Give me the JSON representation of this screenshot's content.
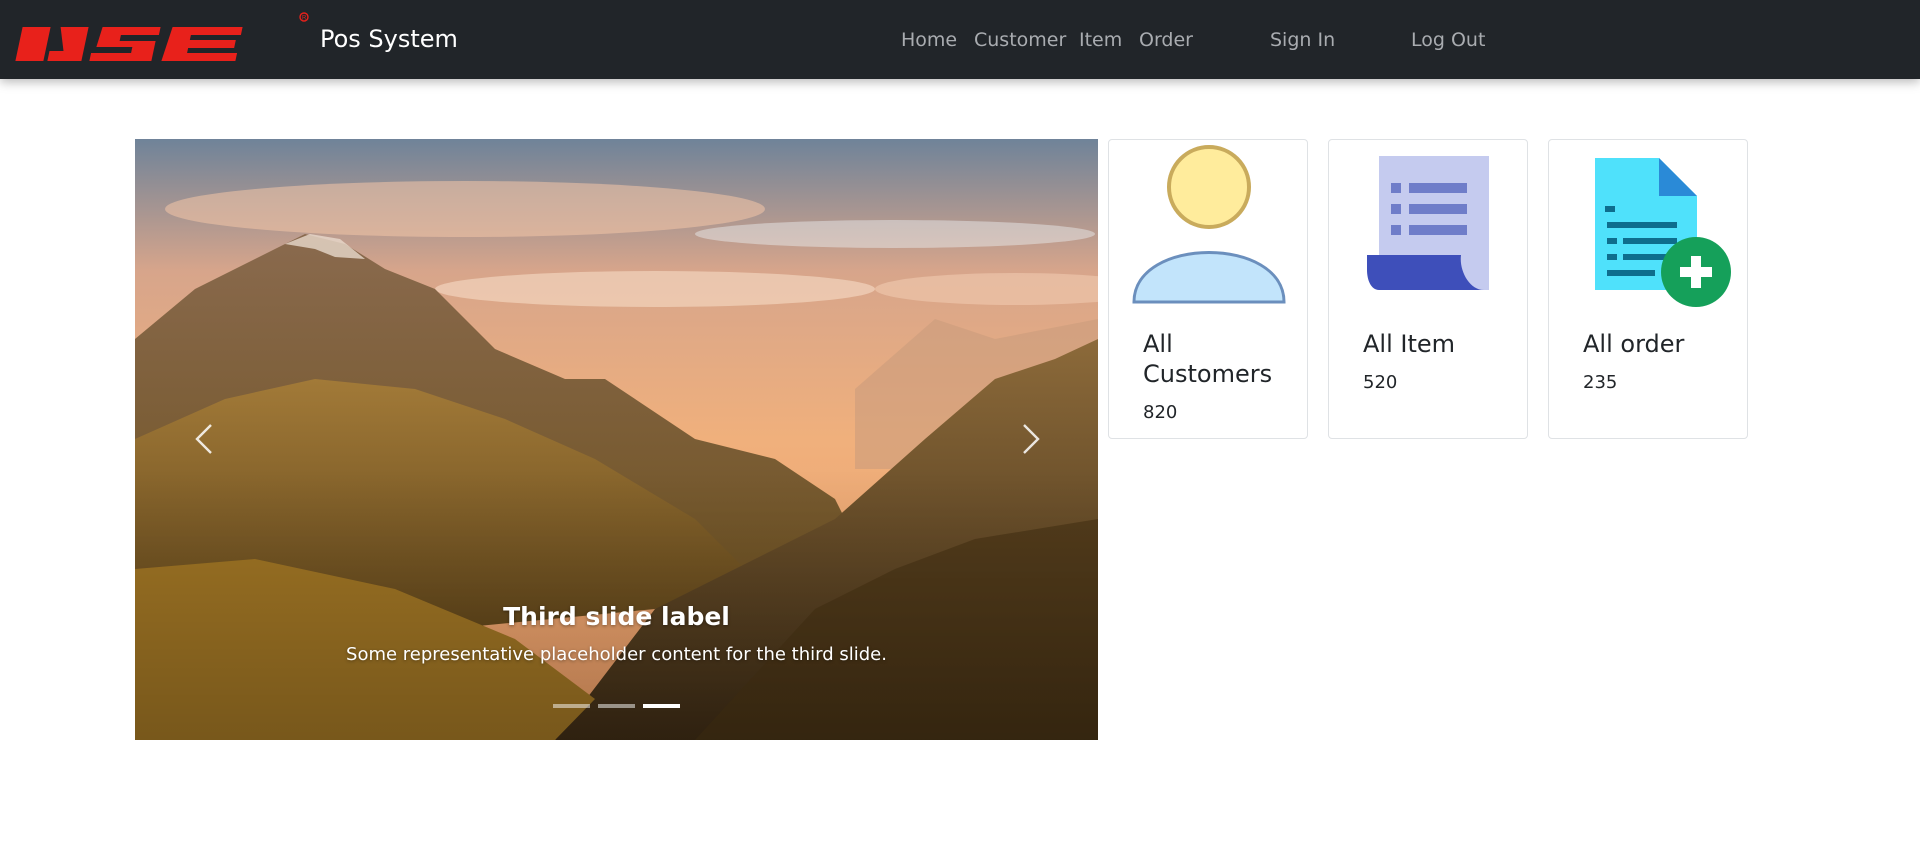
{
  "navbar": {
    "logo_text": "IJSE",
    "brand": "Pos System",
    "links": [
      "Home",
      "Customer",
      "Item",
      "Order"
    ],
    "sign_in": "Sign In",
    "log_out": "Log Out"
  },
  "carousel": {
    "caption_title": "Third slide label",
    "caption_text": "Some representative placeholder content for the third slide.",
    "slide_count": 3,
    "active_index": 2
  },
  "cards": [
    {
      "title": "All Customers",
      "count": "820",
      "icon": "user-icon"
    },
    {
      "title": "All Item",
      "count": "520",
      "icon": "document-list-icon"
    },
    {
      "title": "All order",
      "count": "235",
      "icon": "add-document-icon"
    }
  ],
  "colors": {
    "navbar_bg": "#212529",
    "logo_red": "#e8211b",
    "nav_link": "#a9acb0"
  }
}
